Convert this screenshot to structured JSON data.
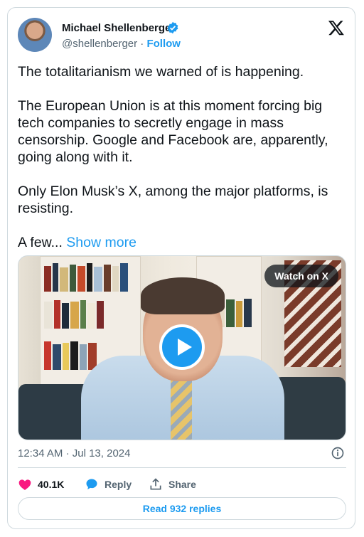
{
  "author": {
    "name": "Michael Shellenberger",
    "handle": "@shellenberger",
    "separator": "·",
    "follow_label": "Follow"
  },
  "tweet": {
    "paragraphs": [
      "The totalitarianism we warned of is happening.",
      "The European Union is at this moment forcing big tech companies to secretly engage in mass censorship. Google and Facebook are, apparently, going along with it.",
      "Only Elon Musk’s X, among the major platforms, is resisting."
    ],
    "truncated_text": "A few...",
    "show_more_label": "Show more"
  },
  "media": {
    "watch_label": "Watch on X"
  },
  "meta": {
    "time": "12:34 AM",
    "separator": "·",
    "date": "Jul 13, 2024"
  },
  "actions": {
    "likes": "40.1K",
    "reply_label": "Reply",
    "share_label": "Share"
  },
  "footer": {
    "replies_label": "Read 932 replies"
  },
  "colors": {
    "accent": "#1d9bf0",
    "like": "#f91880",
    "muted": "#536471"
  },
  "icons": [
    "verified-badge-icon",
    "x-logo-icon",
    "play-icon",
    "info-icon",
    "heart-icon",
    "reply-bubble-icon",
    "share-icon"
  ]
}
